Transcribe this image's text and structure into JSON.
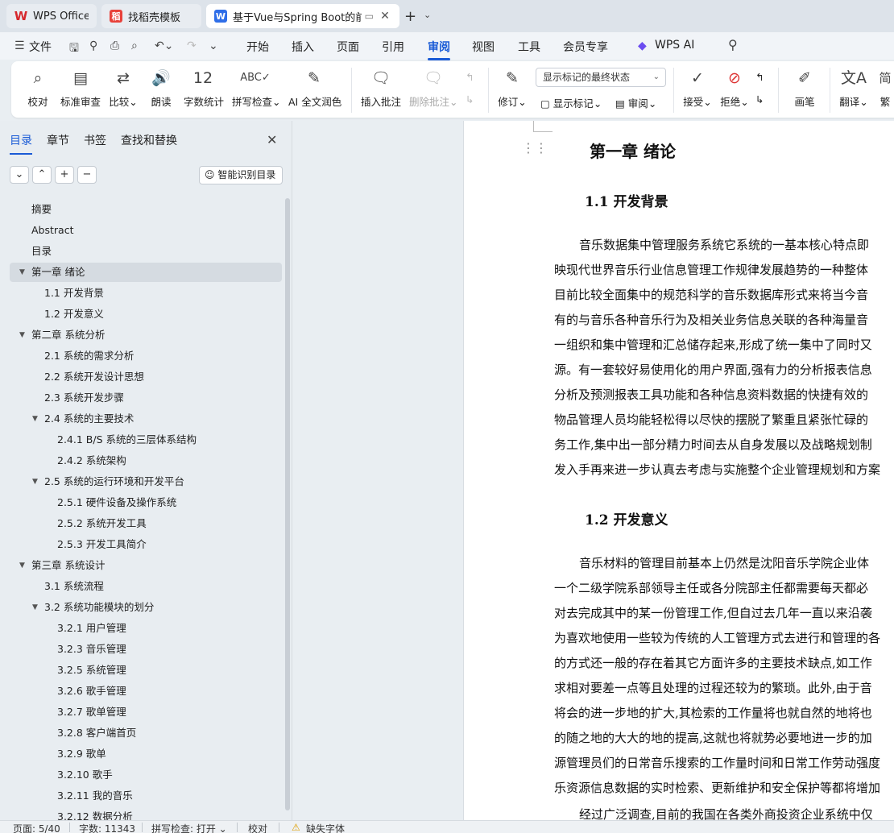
{
  "tabs": [
    {
      "label": "WPS Office",
      "icon": "wps-logo-icon"
    },
    {
      "label": "找稻壳模板",
      "icon": "daoke-icon"
    },
    {
      "label": "基于Vue与Spring Boot的前后",
      "icon": "word-doc-icon",
      "active": true
    }
  ],
  "menu": {
    "file": "文件",
    "items": [
      "开始",
      "插入",
      "页面",
      "引用",
      "审阅",
      "视图",
      "工具",
      "会员专享"
    ],
    "active": "审阅",
    "wps_ai": "WPS AI"
  },
  "ribbon": {
    "proofread": "校对",
    "std_review": "标准审查",
    "compare": "比较",
    "read_aloud": "朗读",
    "word_count": "字数统计",
    "spell_check": "拼写检查",
    "ai_polish": "AI 全文润色",
    "insert_comment": "插入批注",
    "delete_comment": "删除批注",
    "track_changes": "修订",
    "markup_mode": "显示标记的最终状态",
    "show_markup": "显示标记",
    "review": "审阅",
    "accept": "接受",
    "reject": "拒绝",
    "pen": "画笔",
    "translate": "翻译",
    "trad_simp": "繁"
  },
  "nav": {
    "tabs": [
      "目录",
      "章节",
      "书签",
      "查找和替换"
    ],
    "active_tab": "目录",
    "smart_toc": "智能识别目录",
    "toc": [
      {
        "label": "摘要",
        "level": 1
      },
      {
        "label": "Abstract",
        "level": 1
      },
      {
        "label": "目录",
        "level": 1
      },
      {
        "label": "第一章  绪论",
        "level": 1,
        "expanded": true,
        "selected": true
      },
      {
        "label": "1.1 开发背景",
        "level": 2
      },
      {
        "label": "1.2 开发意义",
        "level": 2
      },
      {
        "label": "第二章  系统分析",
        "level": 1,
        "expanded": true
      },
      {
        "label": "2.1 系统的需求分析",
        "level": 2
      },
      {
        "label": "2.2 系统开发设计思想",
        "level": 2
      },
      {
        "label": "2.3 系统开发步骤",
        "level": 2
      },
      {
        "label": "2.4 系统的主要技术",
        "level": 2,
        "expanded": true
      },
      {
        "label": "2.4.1 B/S 系统的三层体系结构",
        "level": 3
      },
      {
        "label": "2.4.2 系统架构",
        "level": 3
      },
      {
        "label": "2.5 系统的运行环境和开发平台",
        "level": 2,
        "expanded": true
      },
      {
        "label": "2.5.1 硬件设备及操作系统",
        "level": 3
      },
      {
        "label": "2.5.2 系统开发工具",
        "level": 3
      },
      {
        "label": "2.5.3 开发工具简介",
        "level": 3
      },
      {
        "label": "第三章  系统设计",
        "level": 1,
        "expanded": true
      },
      {
        "label": "3.1 系统流程",
        "level": 2
      },
      {
        "label": "3.2 系统功能模块的划分",
        "level": 2,
        "expanded": true
      },
      {
        "label": "3.2.1 用户管理",
        "level": 3
      },
      {
        "label": "3.2.3 音乐管理",
        "level": 3
      },
      {
        "label": "3.2.5 系统管理",
        "level": 3
      },
      {
        "label": "3.2.6 歌手管理",
        "level": 3
      },
      {
        "label": "3.2.7 歌单管理",
        "level": 3
      },
      {
        "label": "3.2.8 客户端首页",
        "level": 3
      },
      {
        "label": "3.2.9 歌单",
        "level": 3
      },
      {
        "label": "3.2.10 歌手",
        "level": 3
      },
      {
        "label": "3.2.11 我的音乐",
        "level": 3
      },
      {
        "label": "3.2.12 数据分析",
        "level": 3
      }
    ]
  },
  "document": {
    "chapter_title": "第一章  绪论",
    "section1_title": "1.1 开发背景",
    "para1": [
      "音乐数据集中管理服务系统它系统的一基本核心特点即",
      "映现代世界音乐行业信息管理工作规律发展趋势的一种整体",
      "目前比较全面集中的规范科学的音乐数据库形式来将当今音",
      "有的与音乐各种音乐行为及相关业务信息关联的各种海量音",
      "一组织和集中管理和汇总储存起来,形成了统一集中了同时又",
      "源。有一套较好易使用化的用户界面,强有力的分析报表信息",
      "分析及预测报表工具功能和各种信息资料数据的快捷有效的",
      "物品管理人员均能轻松得以尽快的摆脱了繁重且紧张忙碌的",
      "务工作,集中出一部分精力时间去从自身发展以及战略规划制",
      "发入手再来进一步认真去考虑与实施整个企业管理规划和方案"
    ],
    "section2_title": "1.2 开发意义",
    "para2": [
      "音乐材料的管理目前基本上仍然是沈阳音乐学院企业体",
      "一个二级学院系部领导主任或各分院部主任都需要每天都必",
      "对去完成其中的某一份管理工作,但自过去几年一直以来沿袭",
      "为喜欢地使用一些较为传统的人工管理方式去进行和管理的各",
      "的方式还一般的存在着其它方面许多的主要技术缺点,如工作",
      "求相对要差一点等且处理的过程还较为的繁琐。此外,由于音",
      "将会的进一步地的扩大,其检索的工作量将也就自然的地将也",
      "的随之地的大大的地的提高,这就也将就势必要地进一步的加",
      "源管理员们的日常音乐搜索的工作量时间和日常工作劳动强度",
      "乐资源信息数据的实时检索、更新维护和安全保护等都将增加"
    ],
    "para3_start": "经过广泛调查,目前的我国在各类外商投资企业系统中仅"
  },
  "status": {
    "page": "页面: 5/40",
    "words": "字数: 11343",
    "spell": "拼写检查: 打开",
    "proof": "校对",
    "missing_font": "缺失字体"
  }
}
